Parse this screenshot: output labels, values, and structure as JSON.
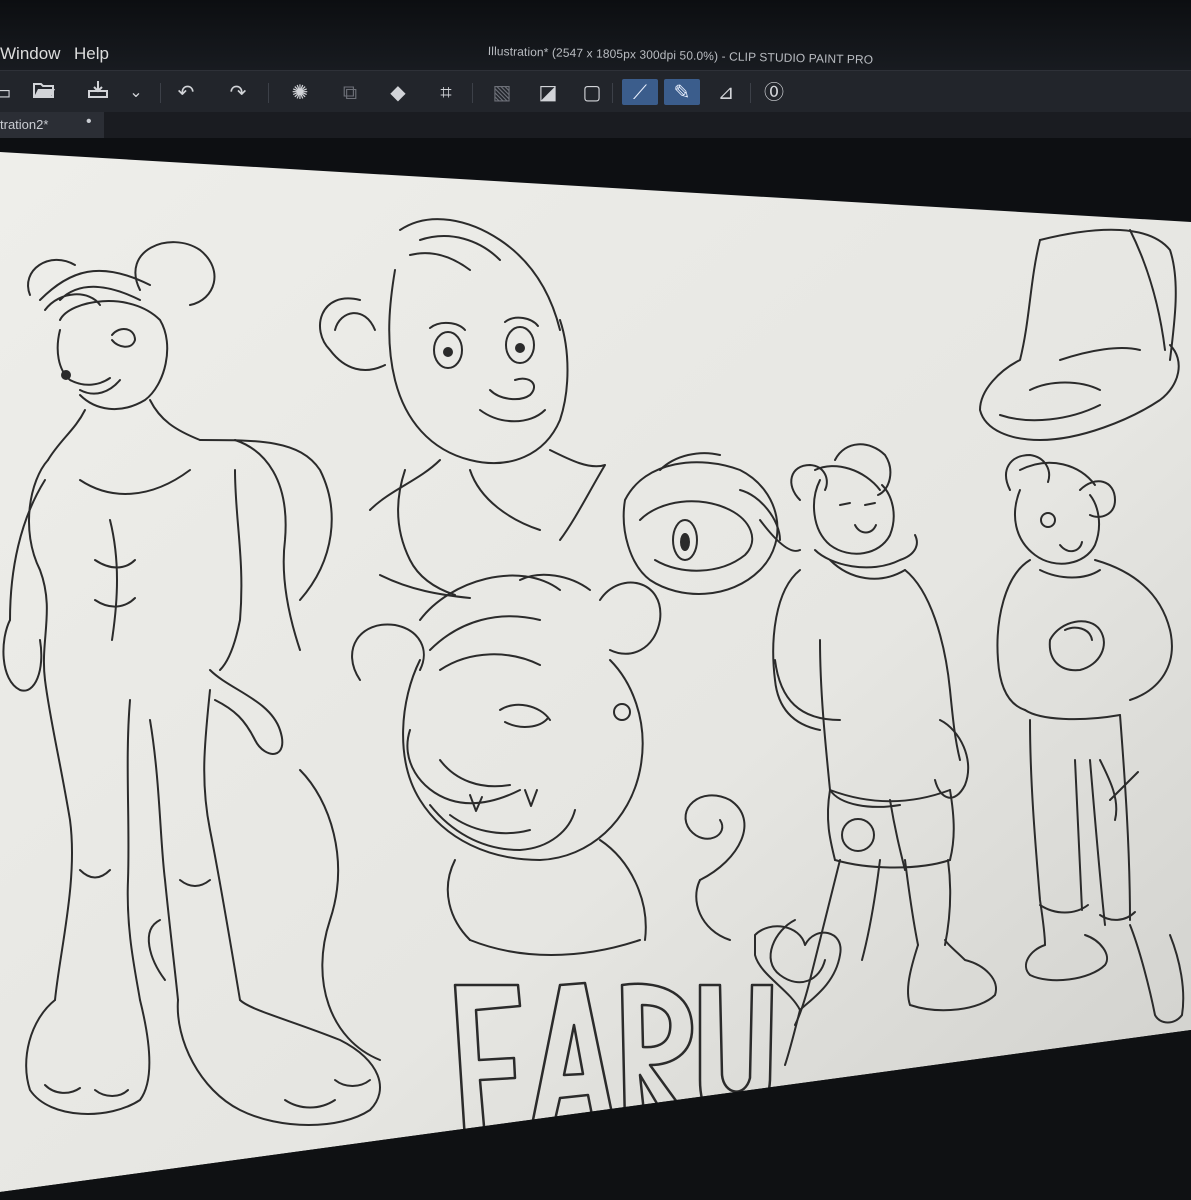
{
  "menu": {
    "window": "Window",
    "help": "Help"
  },
  "window_title": "Illustration* (2547 x 1805px 300dpi 50.0%)  - CLIP STUDIO PAINT PRO",
  "tab": {
    "label": "tration2*",
    "modified_marker": "•"
  },
  "toolbar": {
    "icons": [
      "new-file-icon",
      "open-folder-icon",
      "save-icon",
      "dropdown-chevron-icon",
      "undo-icon",
      "redo-icon",
      "clear-selection-icon",
      "copy-layer-icon",
      "fill-icon",
      "crop-icon",
      "show-selection-icon",
      "tone-icon",
      "border-icon",
      "pen-tool-icon",
      "brush-tool-icon",
      "line-tool-icon",
      "help-icon"
    ]
  },
  "canvas": {
    "lettering": "FARU"
  }
}
